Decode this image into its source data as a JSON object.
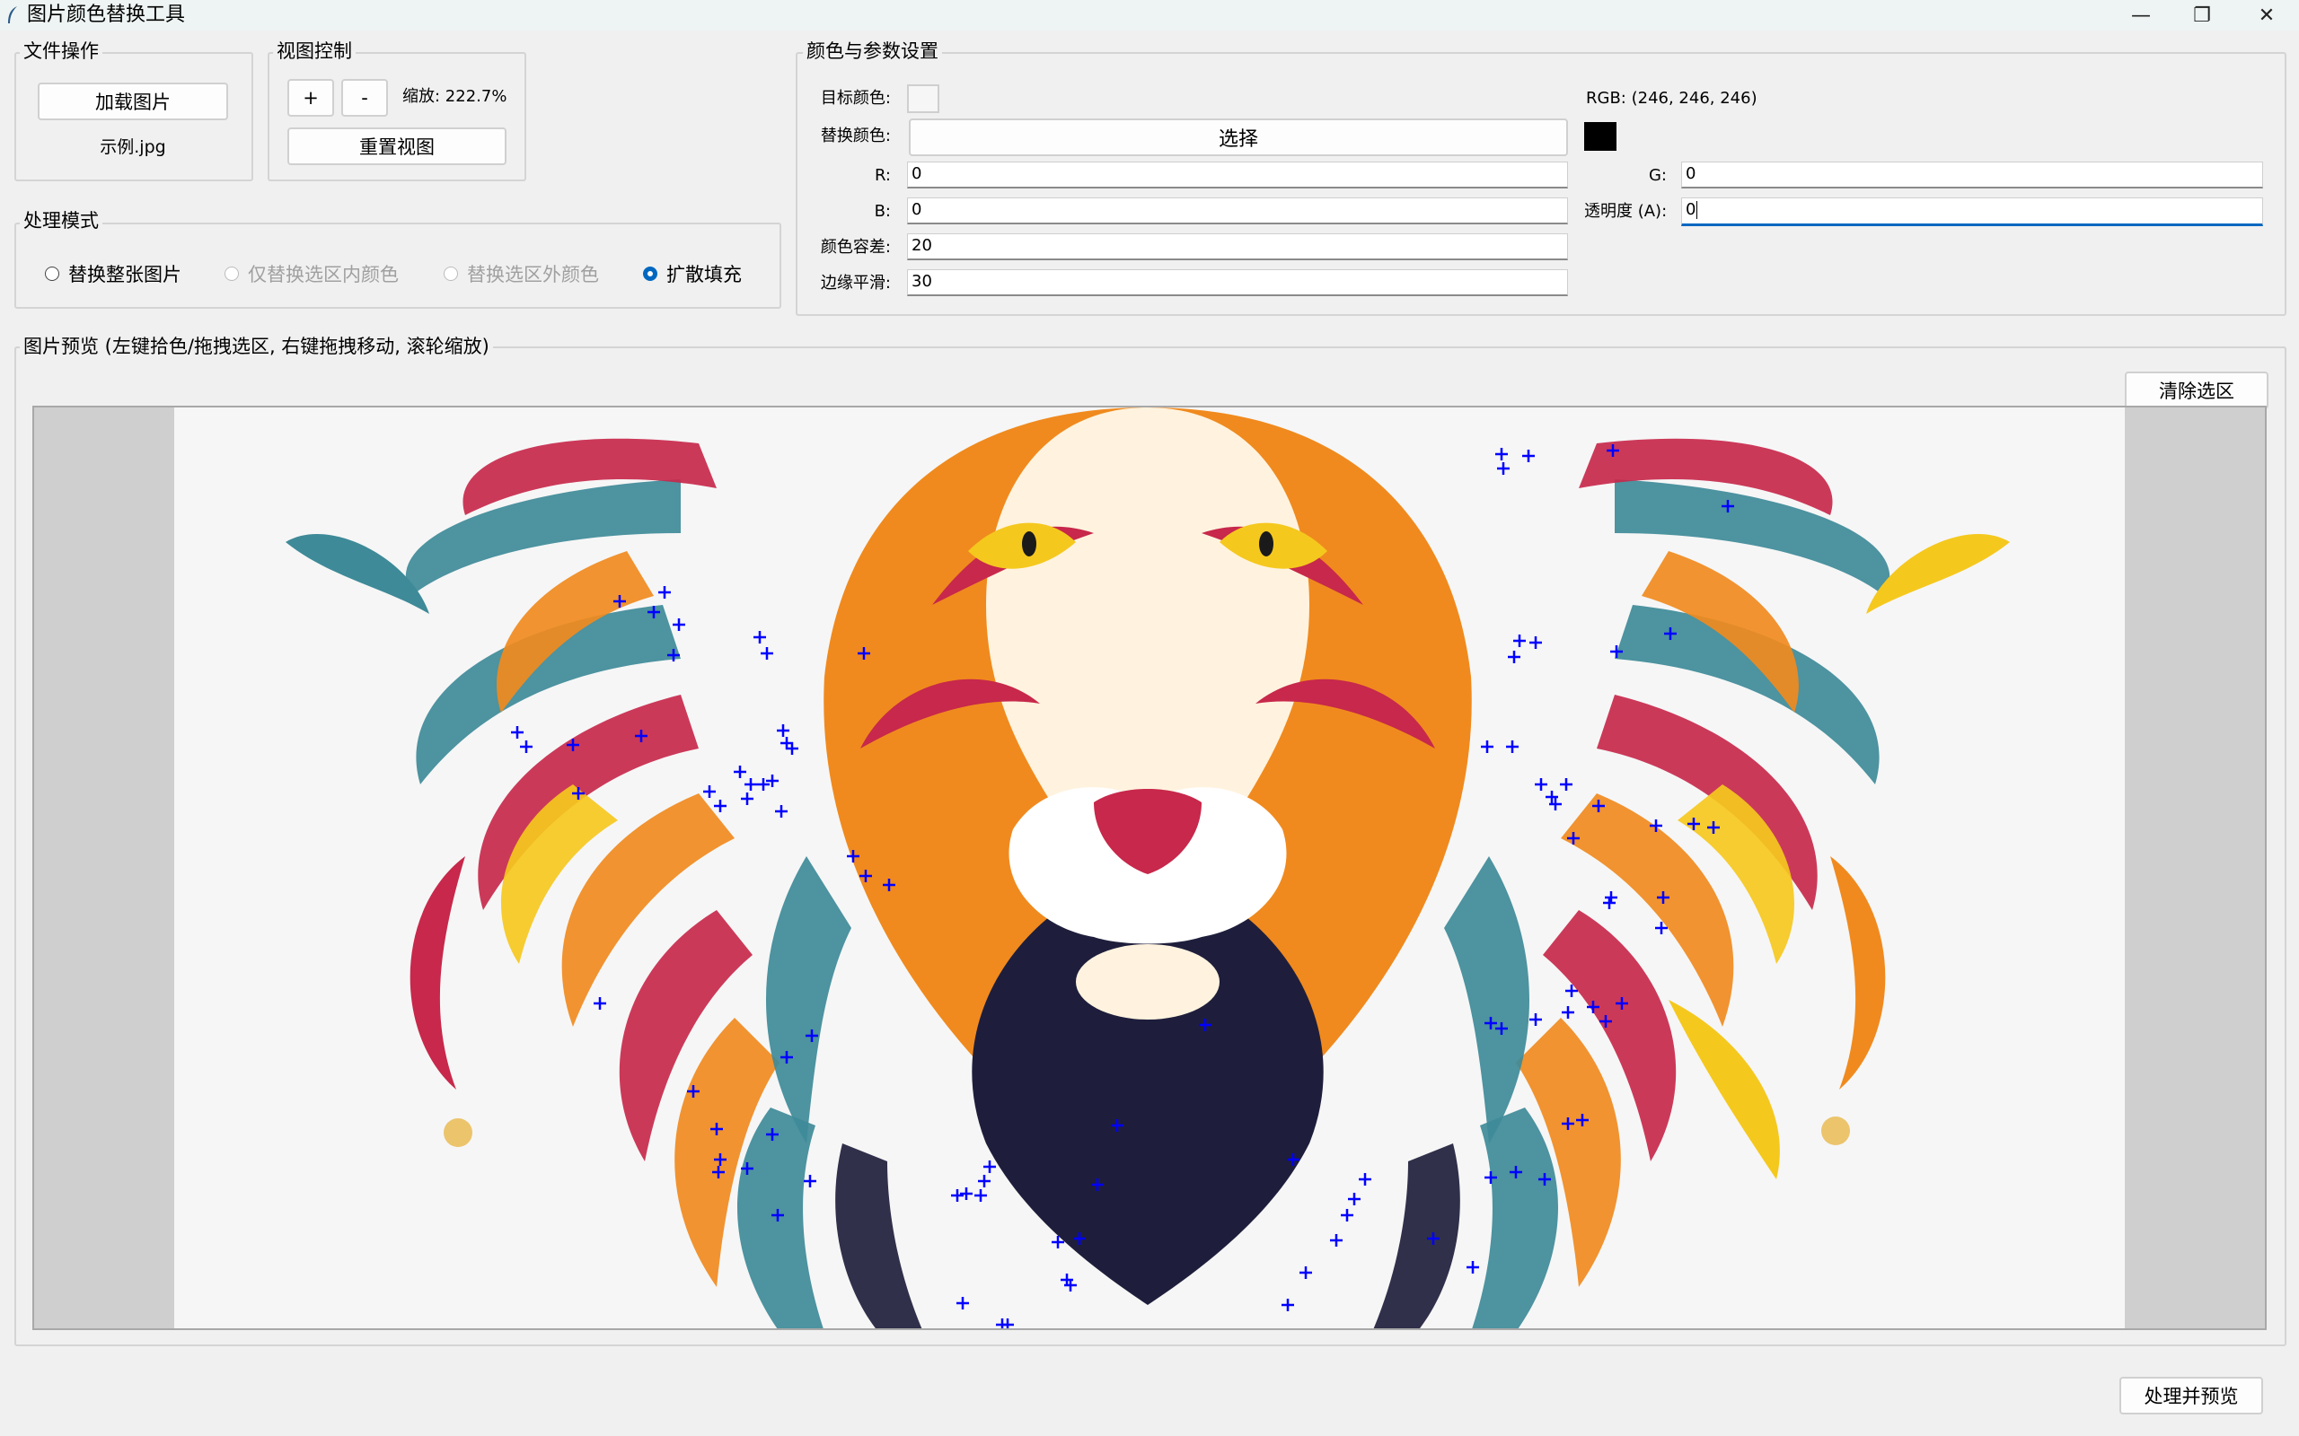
{
  "window": {
    "title": "图片颜色替换工具",
    "controls": [
      "—",
      "❐",
      "✕"
    ]
  },
  "file_ops": {
    "title": "文件操作",
    "load_button": "加载图片",
    "filename": "示例.jpg"
  },
  "view_ctrl": {
    "title": "视图控制",
    "zoom_in": "+",
    "zoom_out": "-",
    "zoom_text": "缩放: 222.7%",
    "reset_button": "重置视图"
  },
  "color_params": {
    "title": "颜色与参数设置",
    "target_label": "目标颜色:",
    "target_color": "#f6f6f6",
    "rgb_readout": "RGB: (246, 246, 246)",
    "replace_label": "替换颜色:",
    "choose_button": "选择",
    "replace_color": "#000000",
    "r_label": "R:",
    "r_value": "0",
    "g_label": "G:",
    "g_value": "0",
    "b_label": "B:",
    "b_value": "0",
    "a_label": "透明度 (A):",
    "a_value": "0",
    "tolerance_label": "颜色容差:",
    "tolerance_value": "20",
    "smooth_label": "边缘平滑:",
    "smooth_value": "30"
  },
  "mode": {
    "title": "处理模式",
    "options": [
      {
        "label": "替换整张图片",
        "state": "enabled"
      },
      {
        "label": "仅替换选区内颜色",
        "state": "disabled"
      },
      {
        "label": "替换选区外颜色",
        "state": "disabled"
      },
      {
        "label": "扩散填充",
        "state": "checked"
      }
    ]
  },
  "preview": {
    "title": "图片预览 (左键拾色/拖拽选区, 右键拖拽移动, 滚轮缩放)",
    "clear_button": "清除选区",
    "image_subject": "colorful-lion-illustration",
    "marker_color": "#0000ff",
    "palette": {
      "teal": "#3e8a98",
      "crimson": "#c7284b",
      "orange": "#f08a1e",
      "yellow": "#f5c81e",
      "navy": "#1e1e3c",
      "cream": "#fff3df",
      "gold": "#e8b84a"
    }
  },
  "footer": {
    "process_button": "处理并预览"
  }
}
